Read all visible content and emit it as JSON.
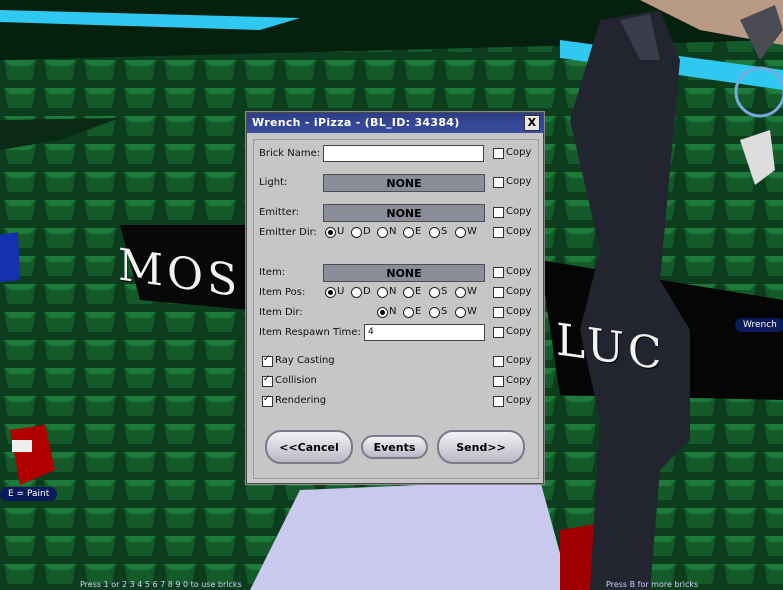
{
  "hud": {
    "paint_hint": "E = Paint",
    "wrench_label": "Wrench",
    "bottom_left": "Press 1 or  2 3 4 5 6 7 8 9 0 to use bricks",
    "bottom_right": "Press B for more bricks",
    "wall_text_1": "MOS",
    "wall_text_2": "LUC"
  },
  "dialog": {
    "title": "Wrench - iPizza - (BL_ID: 34384)",
    "close": "X",
    "copy_label": "Copy",
    "brick_name": {
      "label": "Brick Name:",
      "value": ""
    },
    "light": {
      "label": "Light:",
      "value": "NONE"
    },
    "emitter": {
      "label": "Emitter:",
      "value": "NONE"
    },
    "emitter_dir": {
      "label": "Emitter Dir:",
      "options": [
        "U",
        "D",
        "N",
        "E",
        "S",
        "W"
      ],
      "selected": "U"
    },
    "item": {
      "label": "Item:",
      "value": "NONE"
    },
    "item_pos": {
      "label": "Item Pos:",
      "options": [
        "U",
        "D",
        "N",
        "E",
        "S",
        "W"
      ],
      "selected": "U"
    },
    "item_dir": {
      "label": "Item Dir:",
      "options": [
        "N",
        "E",
        "S",
        "W"
      ],
      "selected": "N"
    },
    "item_respawn": {
      "label": "Item Respawn Time:",
      "value": "4"
    },
    "ray_casting": {
      "label": "Ray Casting",
      "checked": true
    },
    "collision": {
      "label": "Collision",
      "checked": true
    },
    "rendering": {
      "label": "Rendering",
      "checked": true
    },
    "buttons": {
      "cancel": "<<Cancel",
      "events": "Events",
      "send": "Send>>"
    }
  },
  "colors": {
    "titlebar": "#2e3d86",
    "panel": "#c6c6c6",
    "slot": "#8a8c98",
    "floor": "#0b3d1c",
    "cyan": "#2fc8f0"
  }
}
